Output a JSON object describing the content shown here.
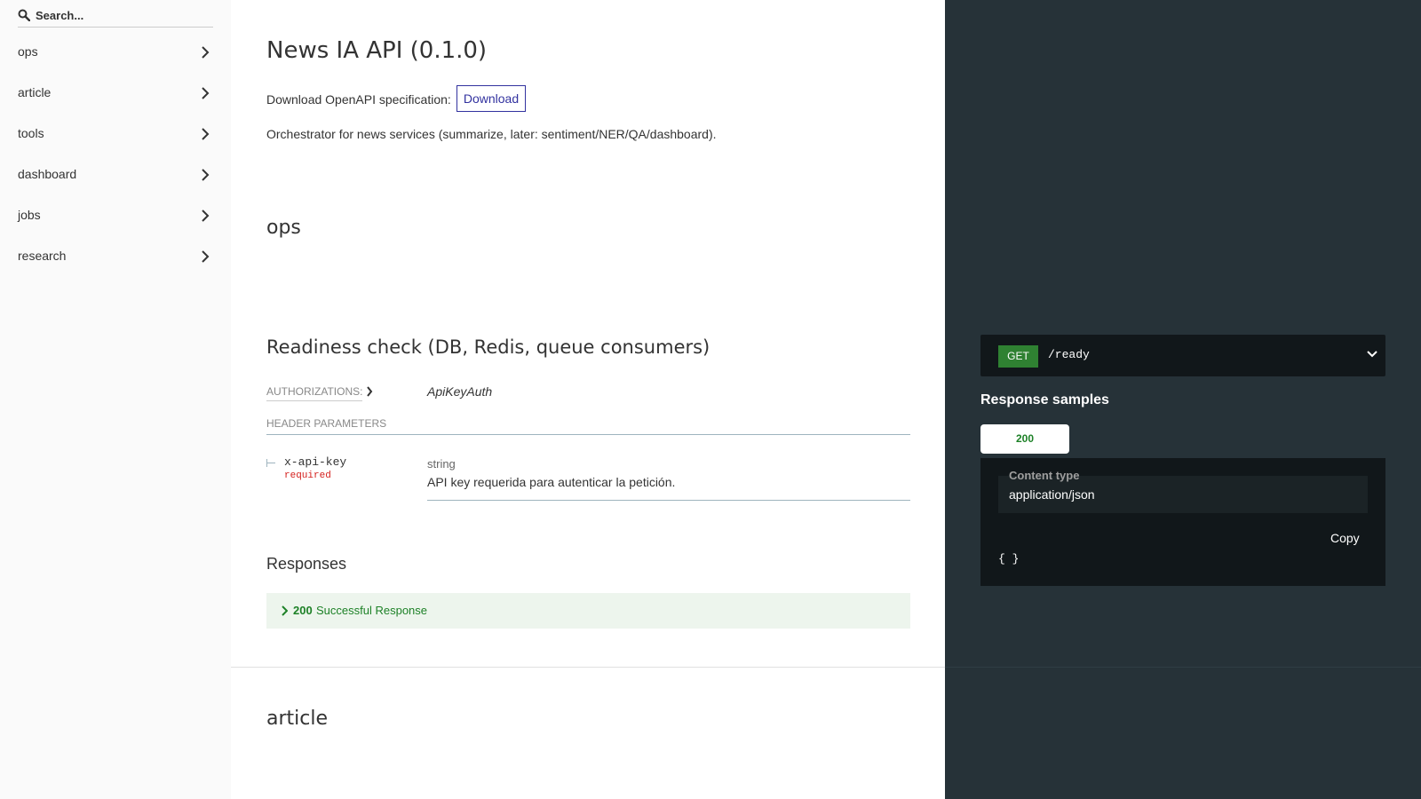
{
  "sidebar": {
    "search_placeholder": "Search...",
    "items": [
      {
        "label": "ops"
      },
      {
        "label": "article"
      },
      {
        "label": "tools"
      },
      {
        "label": "dashboard"
      },
      {
        "label": "jobs"
      },
      {
        "label": "research"
      }
    ]
  },
  "main": {
    "title": "News IA API (0.1.0)",
    "download_label": "Download OpenAPI specification:",
    "download_button": "Download",
    "description": "Orchestrator for news services (summarize, later: sentiment/NER/QA/dashboard).",
    "section_ops": "ops",
    "operation": {
      "title": "Readiness check (DB, Redis, queue consumers)",
      "authorizations_label": "Authorizations:",
      "authorizations_value": "ApiKeyAuth",
      "header_params_label": "Header Parameters",
      "param": {
        "name": "x-api-key",
        "required": "required",
        "type": "string",
        "description": "API key requerida para autenticar la petición."
      },
      "responses_title": "Responses",
      "response": {
        "code": "200",
        "text": "Successful Response"
      }
    },
    "section_article": "article"
  },
  "right": {
    "endpoint": {
      "method": "GET",
      "path": "/ready"
    },
    "samples_title": "Response samples",
    "tab": "200",
    "content_type_label": "Content type",
    "content_type_value": "application/json",
    "copy_label": "Copy",
    "json_body": "{ }"
  },
  "colors": {
    "sidebar_bg": "#fafafa",
    "right_panel_bg": "#263238",
    "method_get": "#2f8132",
    "success_green": "#1d8127",
    "download_accent": "#32329f",
    "required_red": "#d41f1c"
  },
  "icons": {
    "search": "search-icon",
    "nav_chevron": "chevron-right-icon",
    "endpoint_chevron": "chevron-down-icon"
  }
}
